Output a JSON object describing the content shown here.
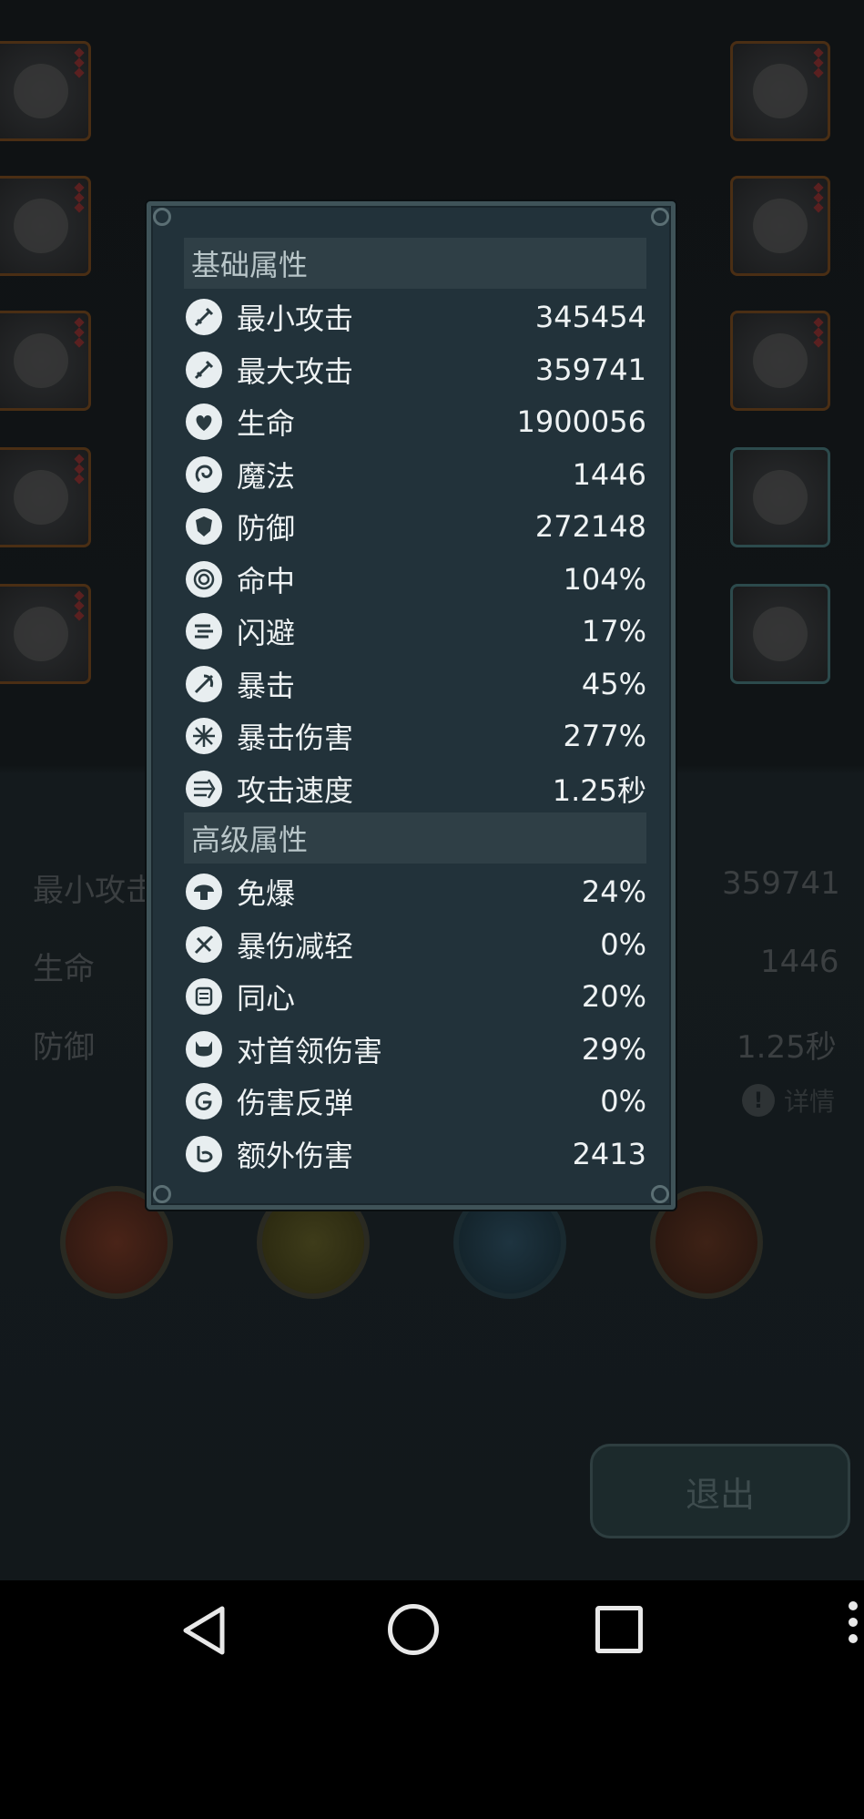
{
  "background": {
    "stats_left": [
      "最小攻击",
      "生命",
      "防御"
    ],
    "stats_right": [
      "359741",
      "1446",
      "1.25秒"
    ],
    "detail_label": "详情",
    "exit_label": "退出"
  },
  "popup": {
    "basic_title": "基础属性",
    "basic_stats": [
      {
        "icon": "sword-icon",
        "label": "最小攻击",
        "value": "345454"
      },
      {
        "icon": "sword-icon",
        "label": "最大攻击",
        "value": "359741"
      },
      {
        "icon": "heart-icon",
        "label": "生命",
        "value": "1900056"
      },
      {
        "icon": "magic-icon",
        "label": "魔法",
        "value": "1446"
      },
      {
        "icon": "shield-icon",
        "label": "防御",
        "value": "272148"
      },
      {
        "icon": "target-icon",
        "label": "命中",
        "value": "104%"
      },
      {
        "icon": "wind-icon",
        "label": "闪避",
        "value": "17%"
      },
      {
        "icon": "crit-icon",
        "label": "暴击",
        "value": "45%"
      },
      {
        "icon": "burst-icon",
        "label": "暴击伤害",
        "value": "277%"
      },
      {
        "icon": "speed-icon",
        "label": "攻击速度",
        "value": "1.25秒"
      }
    ],
    "advanced_title": "高级属性",
    "advanced_stats": [
      {
        "icon": "mushroom-icon",
        "label": "免爆",
        "value": "24%"
      },
      {
        "icon": "reduce-icon",
        "label": "暴伤减轻",
        "value": "0%"
      },
      {
        "icon": "scroll-icon",
        "label": "同心",
        "value": "20%"
      },
      {
        "icon": "demon-icon",
        "label": "对首领伤害",
        "value": "29%"
      },
      {
        "icon": "reflect-icon",
        "label": "伤害反弹",
        "value": "0%"
      },
      {
        "icon": "fist-icon",
        "label": "额外伤害",
        "value": "2413"
      }
    ]
  },
  "colors": {
    "popup_bg": "#22323a",
    "section_bg": "#2f3f46",
    "text": "#eef2f3"
  }
}
